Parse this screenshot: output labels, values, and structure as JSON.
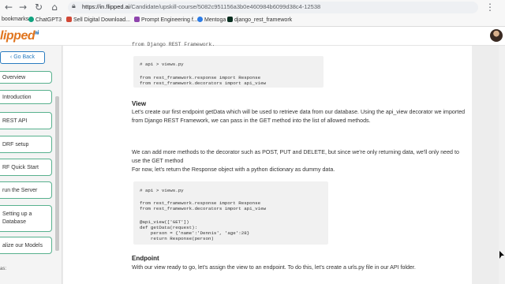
{
  "browser": {
    "url_host": "https://in.flipped.ai",
    "url_path": "/Candidate/upskill-course/5082c951156a3b0e460984b6099d38c4-12538"
  },
  "bookmarks": [
    {
      "label": "bookmarks...",
      "color": "#777777"
    },
    {
      "label": "ChatGPT3",
      "color": "#10a37f"
    },
    {
      "label": "Sell Digital Download...",
      "color": "#d14836"
    },
    {
      "label": "Prompt Engineering f...",
      "color": "#8e44ad"
    },
    {
      "label": "Mentoga",
      "color": "#2c7be5"
    },
    {
      "label": "django_rest_framework",
      "color": "#092e20"
    }
  ],
  "app": {
    "logo": "lipped",
    "logo_suffix": "ai"
  },
  "sidebar": {
    "back_label": "Go Back",
    "items": [
      {
        "label": "Overview"
      },
      {
        "label": "Introduction"
      },
      {
        "label": "REST API"
      },
      {
        "label": "DRF setup"
      },
      {
        "label": "RF Quick Start"
      },
      {
        "label": "run the Server"
      },
      {
        "label": "Setting up a Database"
      },
      {
        "label": "alize our Models"
      }
    ],
    "footer": "as:"
  },
  "content": {
    "cut_line": "from Django REST Framework.",
    "code1": [
      "# api > views.py",
      "",
      "from rest_framework.response import Response",
      "from rest_framework.decorators import api_view"
    ],
    "view_heading": "View",
    "view_para": "Let's create our first endpoint getData which will be used to retrieve data from our database. Using the api_view decorator we imported from Django REST Framework, we can pass in the GET method into the list of allowed methods.",
    "methods_para": "We can add more methods to the decorator such as POST, PUT and DELETE, but since we're only returning data, we'll only need to use the GET method",
    "response_para": "For now, let's return the Response object with a python dictionary as dummy data.",
    "code2": [
      "# api > views.py",
      "",
      "from rest_framework.response import Response",
      "from rest_framework.decorators import api_view",
      "",
      "@api_view(['GET'])",
      "def getData(request):",
      "    person = {'name':'Dennis', 'age':28}",
      "    return Response(person)"
    ],
    "endpoint_heading": "Endpoint",
    "endpoint_para": "With our view ready to go, let's assign the view to an endpoint. To do this, let's create a urls.py file in our API folder."
  }
}
